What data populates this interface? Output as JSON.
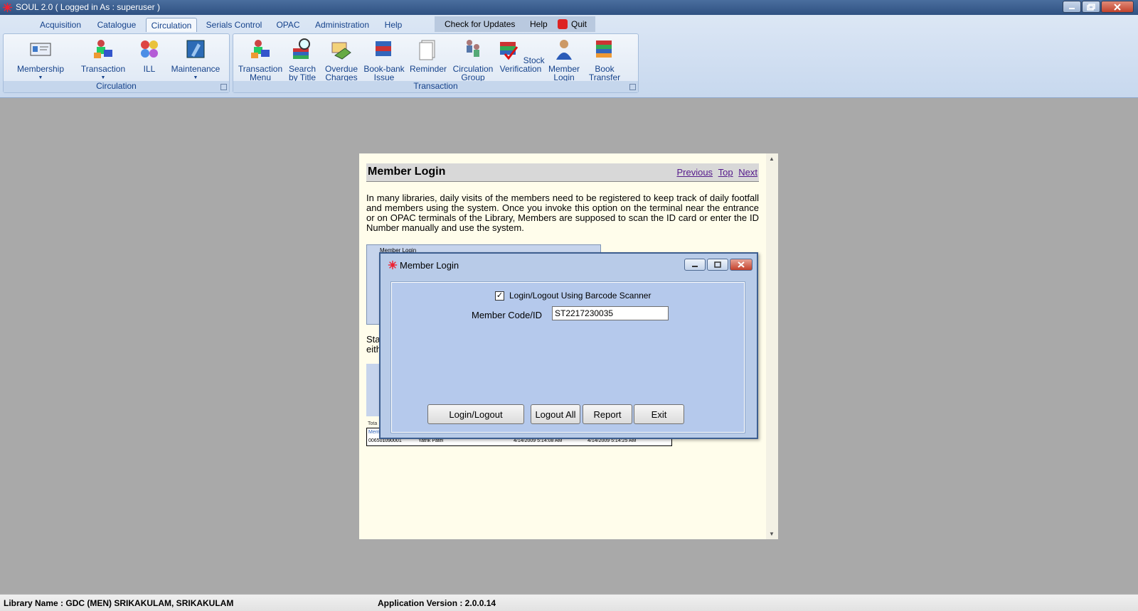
{
  "window": {
    "title": "SOUL 2.0  ( Logged in As : superuser )"
  },
  "ribbon": {
    "tabs": [
      "Acquisition",
      "Catalogue",
      "Circulation",
      "Serials Control",
      "OPAC",
      "Administration",
      "Help"
    ],
    "active_tab": "Circulation",
    "quick_access": {
      "check_updates": "Check for Updates",
      "help": "Help",
      "quit": "Quit"
    },
    "groups": [
      {
        "label": "Circulation",
        "buttons": [
          {
            "label": "Membership",
            "icon": "membership-icon"
          },
          {
            "label": "Transaction",
            "icon": "transaction-icon"
          },
          {
            "label": "ILL",
            "icon": "ill-icon"
          },
          {
            "label": "Maintenance",
            "icon": "maintenance-icon"
          }
        ]
      },
      {
        "label": "Transaction",
        "buttons": [
          {
            "label": "Transaction Menu",
            "line1": "Transaction",
            "line2": "Menu",
            "icon": "transaction-menu-icon"
          },
          {
            "label": "Search by Title",
            "line1": "Search",
            "line2": "by Title",
            "icon": "search-books-icon"
          },
          {
            "label": "Overdue Charges",
            "line1": "Overdue",
            "line2": "Charges",
            "icon": "overdue-charges-icon"
          },
          {
            "label": "Book-bank Issue",
            "line1": "Book-bank",
            "line2": "Issue",
            "icon": "book-bank-icon"
          },
          {
            "label": "Reminder",
            "line1": "Reminder",
            "line2": "",
            "icon": "reminder-icon"
          },
          {
            "label": "Circulation Group",
            "line1": "Circulation",
            "line2": "Group",
            "icon": "circulation-group-icon"
          },
          {
            "label": "Stock Verification",
            "line1": "Stock",
            "line2": "Verification",
            "icon": "stock-verification-icon"
          },
          {
            "label": "Member Login",
            "line1": "Member",
            "line2": "Login",
            "icon": "member-login-icon"
          },
          {
            "label": "Book Transfer",
            "line1": "Book",
            "line2": "Transfer",
            "icon": "book-transfer-icon"
          }
        ]
      }
    ]
  },
  "help_page": {
    "title": "Member Login",
    "nav": {
      "previous": "Previous",
      "top": "Top",
      "next": "Next"
    },
    "paragraph": "In many libraries, daily visits of the members need to be registered to keep track of daily footfall and members using the system.  Once you invoke this option on the terminal near the entrance or on OPAC terminals of the Library, Members are supposed to scan the ID card or enter the ID Number manually and use the system.",
    "fragment1": "Sta",
    "fragment2": "eith",
    "thumbnail_title": "Member Login",
    "mini_total": "Tota",
    "mini_header": "Mem",
    "mini_row": {
      "code": "006501090001",
      "name": "Yatrik Patel",
      "in_time": "4/14/2009 5:14:08 AM",
      "out_time": "4/14/2009 5:14:25 AM"
    }
  },
  "dialog": {
    "title": "Member Login",
    "checkbox_label": "Login/Logout Using Barcode Scanner",
    "checkbox_checked": true,
    "field_label": "Member Code/ID",
    "field_value": "ST2217230035",
    "buttons": {
      "login_logout": "Login/Logout",
      "logout_all": "Logout All",
      "report": "Report",
      "exit": "Exit"
    }
  },
  "statusbar": {
    "library_name": "Library Name : GDC (MEN) SRIKAKULAM, SRIKAKULAM",
    "app_version": "Application Version : 2.0.0.14"
  },
  "colors": {
    "titlebar": "#2f5182",
    "ribbon_text": "#15428b",
    "dialog_bg": "#b8cbe8",
    "help_bg": "#fffdeb",
    "workspace": "#a9a9a9"
  }
}
